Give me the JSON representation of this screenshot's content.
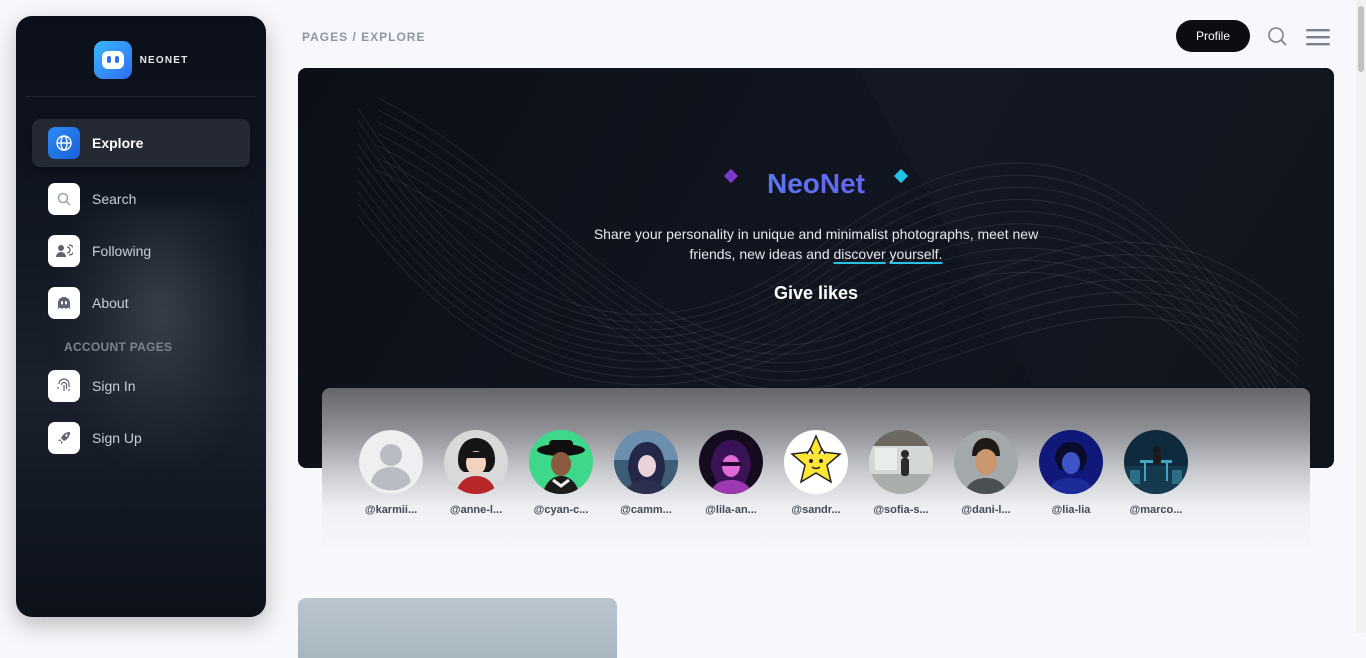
{
  "brand": {
    "name": "NEONET"
  },
  "sidebar": {
    "items": [
      {
        "label": "Explore",
        "icon": "globe-icon",
        "active": true
      },
      {
        "label": "Search",
        "icon": "search-icon"
      },
      {
        "label": "Following",
        "icon": "users-icon"
      },
      {
        "label": "About",
        "icon": "ghost-icon"
      }
    ],
    "section_label": "ACCOUNT PAGES",
    "account_items": [
      {
        "label": "Sign In",
        "icon": "fingerprint-icon"
      },
      {
        "label": "Sign Up",
        "icon": "rocket-icon"
      }
    ]
  },
  "header": {
    "breadcrumb": "PAGES / EXPLORE",
    "profile_label": "Profile",
    "search_icon": "search-icon",
    "menu_icon": "menu-icon"
  },
  "hero": {
    "title": "NeoNet",
    "description_line1": "Share your personality in unique and minimalist photographs, meet new",
    "description_line2_prefix": "friends, new ideas and ",
    "description_link1": "discover",
    "description_space": " ",
    "description_link2": "yourself.",
    "subtitle": "Give likes",
    "accent_colors": [
      "#2fc6f0",
      "#8a3ad9"
    ]
  },
  "stories": [
    {
      "handle": "@karmii..."
    },
    {
      "handle": "@anne-l..."
    },
    {
      "handle": "@cyan-c..."
    },
    {
      "handle": "@camm..."
    },
    {
      "handle": "@lila-an..."
    },
    {
      "handle": "@sandr..."
    },
    {
      "handle": "@sofia-s..."
    },
    {
      "handle": "@dani-l..."
    },
    {
      "handle": "@lia-lia"
    },
    {
      "handle": "@marco..."
    }
  ]
}
